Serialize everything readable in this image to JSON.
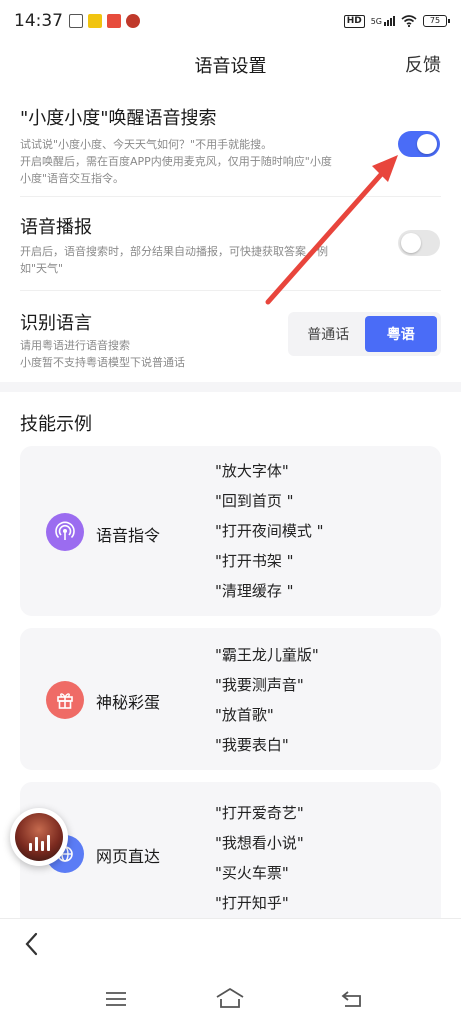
{
  "status_bar": {
    "time": "14:37",
    "hd": "HD",
    "network": "5G",
    "battery": "75"
  },
  "header": {
    "title": "语音设置",
    "feedback": "反馈"
  },
  "settings": {
    "wake": {
      "title": "\"小度小度\"唤醒语音搜索",
      "desc1": "试试说\"小度小度、今天天气如何？\"不用手就能搜。",
      "desc2": "开启唤醒后，需在百度APP内使用麦克风，仅用于随时响应\"小度",
      "desc3": "小度\"语音交互指令。",
      "enabled": true
    },
    "broadcast": {
      "title": "语音播报",
      "desc1": "开启后，语音搜索时，部分结果自动播报，可快捷获取答案，例",
      "desc2": "如\"天气\"",
      "enabled": false
    },
    "language": {
      "title": "识别语言",
      "desc1": "请用粤语进行语音搜索",
      "desc2": "小度暂不支持粤语模型下说普通话",
      "options": [
        "普通话",
        "粤语"
      ],
      "selected": "粤语"
    }
  },
  "skills": {
    "title": "技能示例",
    "cards": [
      {
        "name": "语音指令",
        "icon": "radio-waves-icon",
        "color": "#9b6cf0",
        "examples": [
          "\"放大字体\"",
          "\"回到首页 \"",
          "\"打开夜间模式 \"",
          "\"打开书架 \"",
          "\"清理缓存 \""
        ]
      },
      {
        "name": "神秘彩蛋",
        "icon": "gift-icon",
        "color": "#ef6b66",
        "examples": [
          "\"霸王龙儿童版\"",
          "\"我要测声音\"",
          "\"放首歌\"",
          "\"我要表白\""
        ]
      },
      {
        "name": "网页直达",
        "icon": "globe-icon",
        "color": "#5b7cf5",
        "examples": [
          "\"打开爱奇艺\"",
          "\"我想看小说\"",
          "\"买火车票\"",
          "\"打开知乎\""
        ]
      }
    ]
  },
  "colors": {
    "accent": "#4a6cf7",
    "annotation_arrow": "#e8453c"
  }
}
